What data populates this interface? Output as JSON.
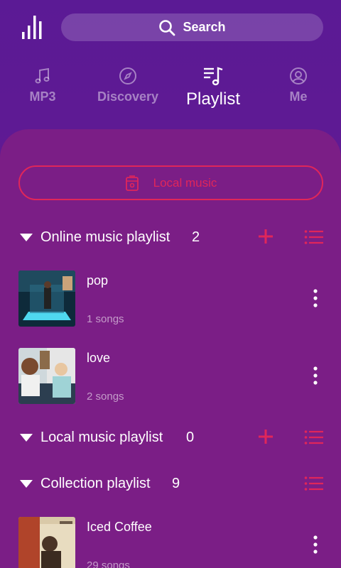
{
  "header": {
    "search_label": "Search"
  },
  "tabs": [
    {
      "label": "MP3",
      "icon": "music-note-icon"
    },
    {
      "label": "Discovery",
      "icon": "compass-icon"
    },
    {
      "label": "Playlist",
      "icon": "playlist-icon",
      "active": true
    },
    {
      "label": "Me",
      "icon": "user-icon"
    }
  ],
  "local_music": {
    "label": "Local music"
  },
  "sections": {
    "online": {
      "title": "Online music playlist",
      "count": "2"
    },
    "local": {
      "title": "Local music playlist",
      "count": "0"
    },
    "collection": {
      "title": "Collection playlist",
      "count": "9"
    }
  },
  "online_playlists": [
    {
      "name": "pop",
      "songs": "1 songs"
    },
    {
      "name": "love",
      "songs": "2 songs"
    }
  ],
  "collection_playlists": [
    {
      "name": "Iced Coffee",
      "songs": "29 songs"
    }
  ],
  "colors": {
    "accent": "#e0265a",
    "background": "#5b1a95",
    "panel": "#7b1e86"
  }
}
